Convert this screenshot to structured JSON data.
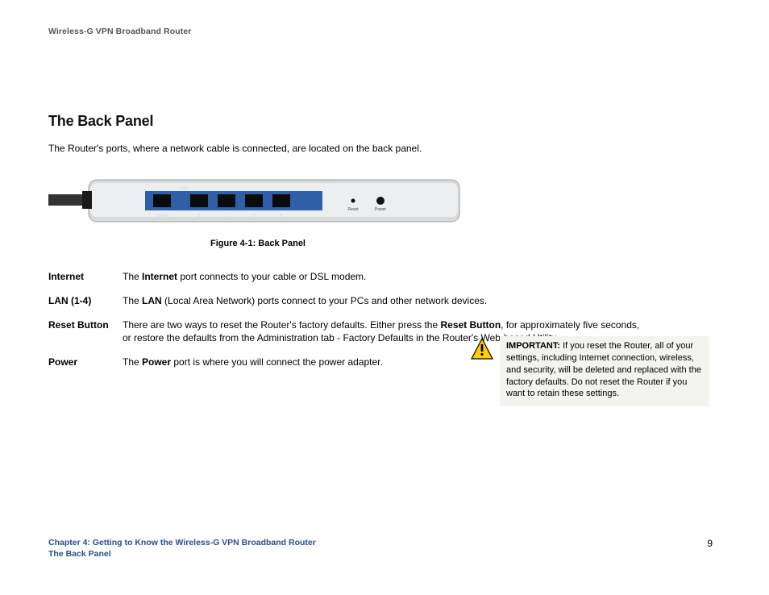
{
  "header": {
    "running": "Wireless-G VPN Broadband Router"
  },
  "section": {
    "title": "The Back Panel",
    "intro": "The Router's ports, where a network cable is connected, are located on the back panel."
  },
  "figure": {
    "caption": "Figure 4-1: Back Panel",
    "labels": {
      "internet": "Internet",
      "lan": "LAN",
      "p1": "1",
      "p2": "2",
      "p3": "3",
      "p4": "4",
      "reset": "Reset",
      "power": "Power"
    }
  },
  "defs": {
    "internet": {
      "term": "Internet",
      "pre": "The ",
      "bold": "Internet",
      "post": " port connects to your cable or DSL modem."
    },
    "lan": {
      "term": "LAN (1-4)",
      "pre": "The ",
      "bold": "LAN",
      "post": " (Local Area Network) ports connect to your PCs and other network devices."
    },
    "reset": {
      "term": "Reset Button",
      "pre": "There are two ways to reset the Router's factory defaults. Either press the ",
      "bold": "Reset Button",
      "post": ", for approximately five seconds, or restore the defaults from the Administration tab - Factory Defaults in the Router's Web-based Utility."
    },
    "power": {
      "term": "Power",
      "pre": "The ",
      "bold": "Power",
      "post": " port is where you will connect the power adapter."
    }
  },
  "callout": {
    "bold": "IMPORTANT:",
    "text": " If you reset the Router, all of your settings, including Internet connection, wireless, and security, will be deleted and replaced with the factory defaults. Do not reset the Router if you want to retain these settings."
  },
  "footer": {
    "line1": "Chapter 4: Getting to Know the Wireless-G VPN Broadband Router",
    "line2": "The Back Panel",
    "page": "9"
  }
}
